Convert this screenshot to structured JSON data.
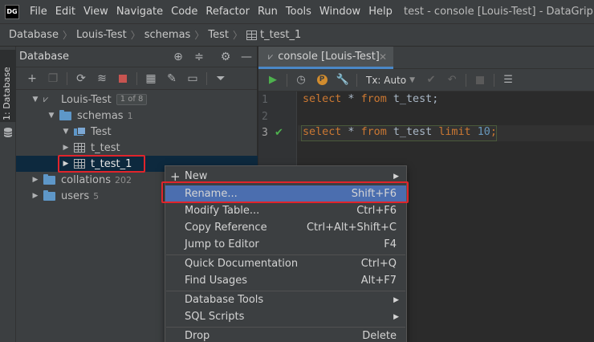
{
  "app": {
    "logo_text": "DG",
    "window_title": "test - console [Louis-Test] - DataGrip"
  },
  "menu": [
    "File",
    "Edit",
    "View",
    "Navigate",
    "Code",
    "Refactor",
    "Run",
    "Tools",
    "Window",
    "Help"
  ],
  "breadcrumb": [
    "Database",
    "Louis-Test",
    "schemas",
    "Test",
    "t_test_1"
  ],
  "side_stripe": {
    "label": "1: Database"
  },
  "db_panel": {
    "title": "Database",
    "tree": {
      "datasource": {
        "label": "Louis-Test",
        "badge": "1 of 8"
      },
      "schemas": {
        "label": "schemas",
        "count": "1"
      },
      "schema_test": {
        "label": "Test"
      },
      "table_t_test": {
        "label": "t_test"
      },
      "table_t_test_1": {
        "label": "t_test_1"
      },
      "collations": {
        "label": "collations",
        "count": "202"
      },
      "users": {
        "label": "users",
        "count": "5"
      }
    }
  },
  "editor": {
    "tab_label": "console [Louis-Test]",
    "tx_mode": "Tx: Auto",
    "lines": [
      {
        "no": "1",
        "kw1": "select",
        "rest1": " * ",
        "kw2": "from",
        "rest2": " t_test;"
      },
      {
        "no": "2"
      },
      {
        "no": "3",
        "kw1": "select",
        "rest1": " * ",
        "kw2": "from",
        "rest2": " t_test ",
        "kw3": "limit",
        "num": "10",
        "end": ";"
      }
    ]
  },
  "context_menu": {
    "items": [
      {
        "label": "New",
        "shortcut": "",
        "submenu": true,
        "icon": "plus-icon"
      },
      {
        "label": "Rename...",
        "shortcut": "Shift+F6"
      },
      {
        "label": "Modify Table...",
        "shortcut": "Ctrl+F6"
      },
      {
        "label": "Copy Reference",
        "shortcut": "Ctrl+Alt+Shift+C"
      },
      {
        "label": "Jump to Editor",
        "shortcut": "F4"
      },
      {
        "label": "Quick Documentation",
        "shortcut": "Ctrl+Q"
      },
      {
        "label": "Find Usages",
        "shortcut": "Alt+F7"
      },
      {
        "label": "Database Tools",
        "shortcut": "",
        "submenu": true
      },
      {
        "label": "SQL Scripts",
        "shortcut": "",
        "submenu": true
      },
      {
        "label": "Drop",
        "shortcut": "Delete"
      }
    ]
  },
  "colors": {
    "highlight": "#4b6eaf",
    "annotation_red": "#e0242b",
    "keyword": "#cc7832",
    "number": "#6897bb"
  }
}
